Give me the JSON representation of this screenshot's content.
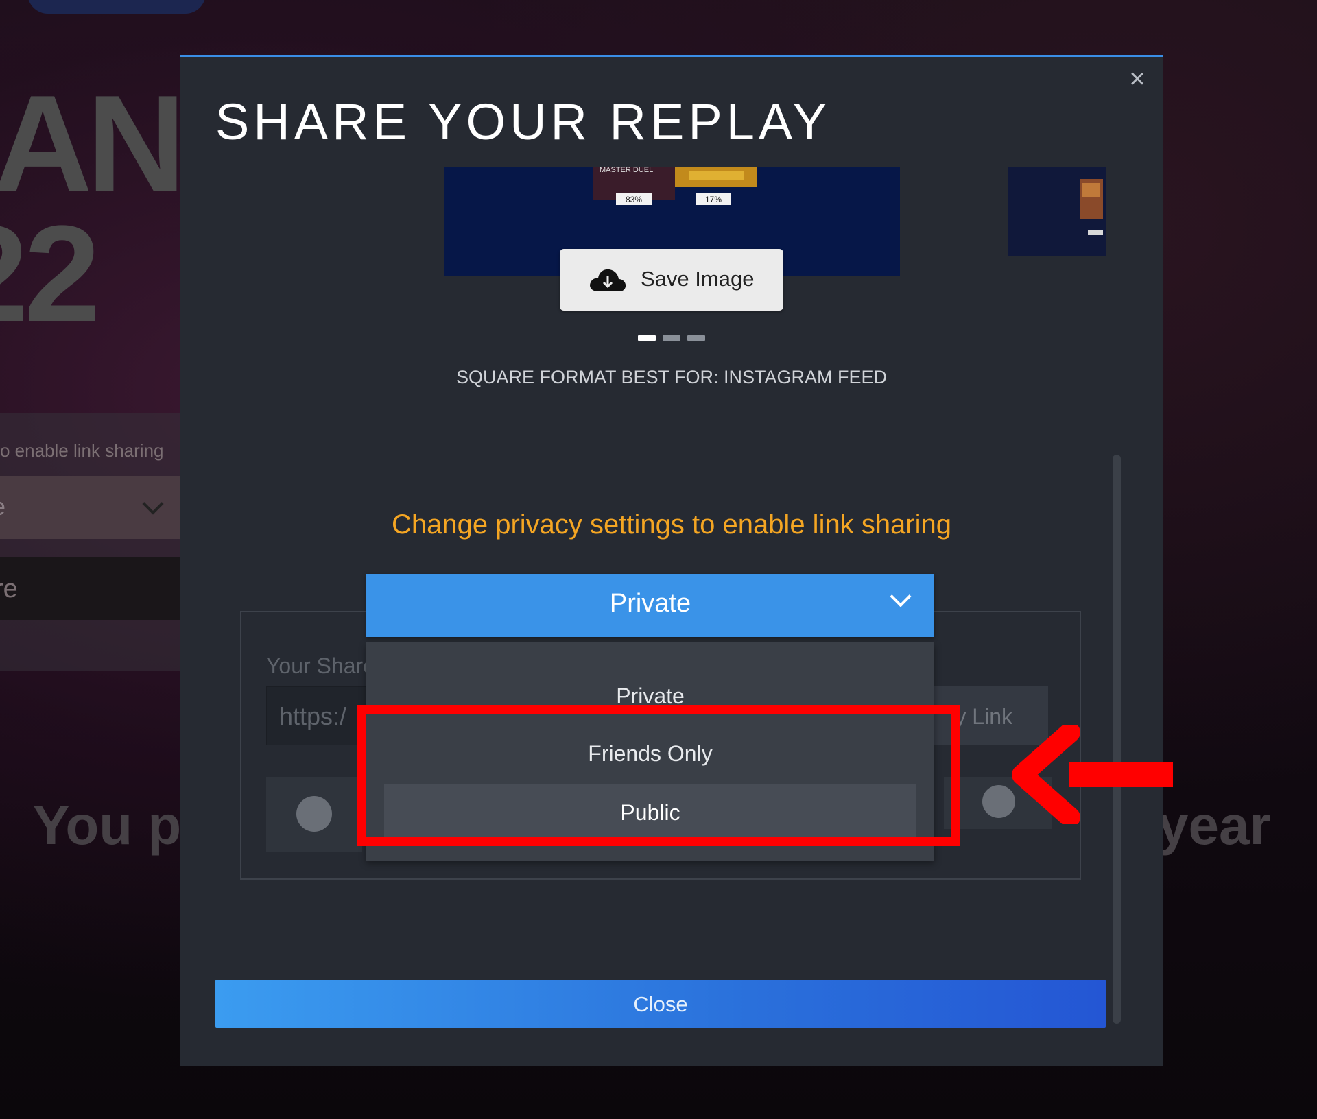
{
  "background": {
    "headline_fragment": "AN",
    "year_fragment": "22",
    "hint_fragment": "o enable link sharing",
    "select_fragment": "e",
    "share_fragment": "re",
    "footer_left_fragment": "You p",
    "footer_right_fragment": "year"
  },
  "modal": {
    "title": "SHARE YOUR REPLAY",
    "close_symbol": "×",
    "preview": {
      "brand_text": "MASTER DUEL",
      "stat_left": "83%",
      "stat_right": "17%"
    },
    "save_image_label": "Save Image",
    "carousel": {
      "count": 3,
      "active_index": 0
    },
    "format_caption": "SQUARE FORMAT BEST FOR: INSTAGRAM FEED",
    "privacy_warning": "Change privacy settings to enable link sharing",
    "privacy_select": {
      "value": "Private",
      "options": [
        "Private",
        "Friends Only",
        "Public"
      ],
      "highlighted_option": "Public"
    },
    "share_box": {
      "label_fragment": "Your Share",
      "url_fragment": "https:/",
      "copy_fragment": "y Link"
    },
    "close_label": "Close"
  },
  "colors": {
    "modal_bg": "#262a32",
    "select_bg": "#3a93e8",
    "warning": "#f5a623",
    "annotation": "#ff0000"
  },
  "icons": [
    "cloud-download-icon",
    "chevron-down-icon",
    "close-icon",
    "steam-icon",
    "reddit-icon",
    "arrow-left-annotation"
  ]
}
